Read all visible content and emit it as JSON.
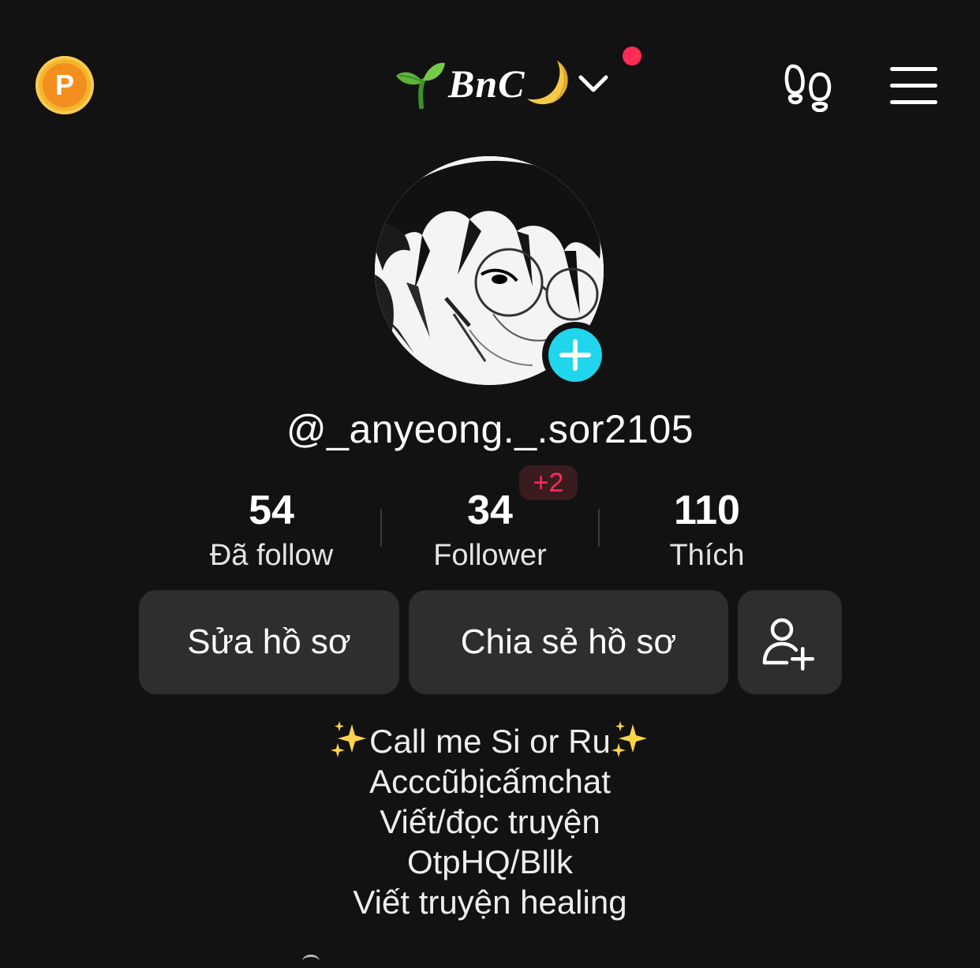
{
  "top_bar": {
    "coin_label": "P",
    "account_name": "BnC"
  },
  "profile": {
    "username": "@_anyeong._.sor2105"
  },
  "stats": {
    "following_count": "54",
    "following_label": "Đã follow",
    "followers_count": "34",
    "followers_label": "Follower",
    "followers_new_badge": "+2",
    "likes_count": "110",
    "likes_label": "Thích"
  },
  "actions": {
    "edit_profile_label": "Sửa hồ sơ",
    "share_profile_label": "Chia sẻ hồ sơ"
  },
  "bio": {
    "line1": "Call me Si or Ru",
    "line2": "Acccũbịcấmchat",
    "line3": "Viết/đọc truyện",
    "line4": "OtpHQ/Bllk",
    "line5": "Viết truyện healing"
  },
  "icons": {
    "coin": "points-coin-icon",
    "sprout": "seedling-emoji-icon",
    "moon": "crescent-moon-emoji-icon",
    "chevron": "chevron-down-icon",
    "footprints": "footprints-icon",
    "menu": "hamburger-menu-icon",
    "add_avatar": "plus-icon",
    "add_friend": "add-friend-icon",
    "sparkles": "sparkles-emoji-icon"
  },
  "colors": {
    "background": "#121212",
    "accent_cyan": "#20d5ec",
    "accent_red": "#fe2c55",
    "button_bg": "#2e2e2e",
    "coin_orange": "#f38f1e"
  }
}
